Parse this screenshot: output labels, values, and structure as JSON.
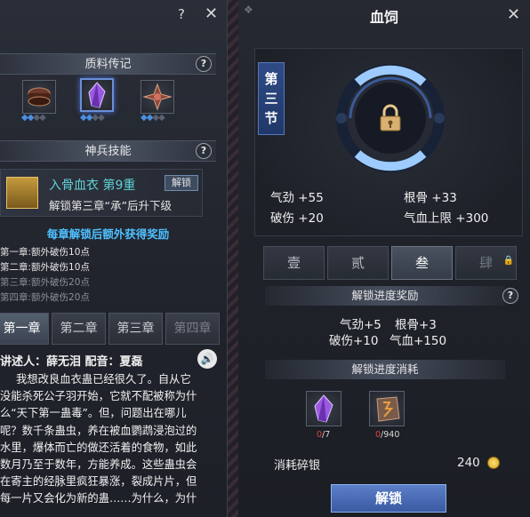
{
  "left": {
    "help_glyph": "?",
    "close_glyph": "✕",
    "material_section": {
      "title": "质料传记",
      "help": "?"
    },
    "materials": [
      {
        "icon": "drum-material-icon",
        "diamonds_on": 2,
        "diamonds_total": 4
      },
      {
        "icon": "purple-crystal-icon",
        "diamonds_on": 2,
        "diamonds_total": 4,
        "selected": true
      },
      {
        "icon": "winged-shuriken-icon",
        "diamonds_on": 2,
        "diamonds_total": 4
      }
    ],
    "skill_section": {
      "title": "神兵技能",
      "help": "?"
    },
    "skill": {
      "name": "入骨血衣 第9重",
      "unlock_label": "解锁",
      "desc": "解锁第三章“承”后升下级"
    },
    "bonus": {
      "title": "每章解锁后额外获得奖励",
      "lines": [
        {
          "text": "第一章:额外破伤10点",
          "unlocked": true
        },
        {
          "text": "第二章:额外破伤10点",
          "unlocked": true
        },
        {
          "text": "第三章:额外破伤20点",
          "unlocked": false
        },
        {
          "text": "第四章:额外破伤20点",
          "unlocked": false
        }
      ]
    },
    "tabs": [
      "第一章",
      "第二章",
      "第三章",
      "第四章"
    ],
    "narration": {
      "label": "讲述人：薛无泪  配音：夏磊",
      "speaker_glyph": "🔊",
      "story_lines": [
        "我想改良血衣蛊已经很久了。自从它",
        "没能杀死公子羽开始，它就不配被称为什",
        "么“天下第一蛊毒”。但，问题出在哪儿",
        "呢？数千条蛊虫，养在被血鹦鹉浸泡过的",
        "水里，爆体而亡的做还活着的食物，如此",
        "数月乃至于数年，方能养成。这些蛊虫会",
        "在寄主的经脉里疯狂暴涨，裂成片片，但",
        "每一片又会化为新的蛊……为什么，为什"
      ]
    }
  },
  "right": {
    "title": "血饲",
    "close_glyph": "✕",
    "chapter_tag": [
      "第",
      "三",
      "节"
    ],
    "lock_icon": "padlock-icon",
    "stats": [
      {
        "label": "气劲",
        "value": "+55"
      },
      {
        "label": "根骨",
        "value": "+33"
      },
      {
        "label": "破伤",
        "value": "+20"
      },
      {
        "label": "气血上限",
        "value": "+300"
      }
    ],
    "tabs": [
      "壹",
      "贰",
      "叁",
      "肆"
    ],
    "reward_section": {
      "title": "解锁进度奖励",
      "help": "?"
    },
    "rewards": [
      {
        "label": "气劲",
        "value": "+5"
      },
      {
        "label": "根骨",
        "value": "+3"
      },
      {
        "label": "破伤",
        "value": "+10"
      },
      {
        "label": "气血",
        "value": "+150"
      }
    ],
    "cost_section": {
      "title": "解锁进度消耗"
    },
    "costs": [
      {
        "icon": "purple-crystal-icon",
        "have": "0",
        "need": "/7"
      },
      {
        "icon": "rune-stone-icon",
        "have": "0",
        "need": "/940"
      }
    ],
    "fee": {
      "label": "消耗碎银",
      "value": "240"
    },
    "unlock_button": "解锁"
  },
  "colors": {
    "accent_blue": "#4fc0ff",
    "skill_teal": "#5fd2d6",
    "insufficient_red": "#e0423a",
    "button_blue": "#4a6cb8"
  }
}
